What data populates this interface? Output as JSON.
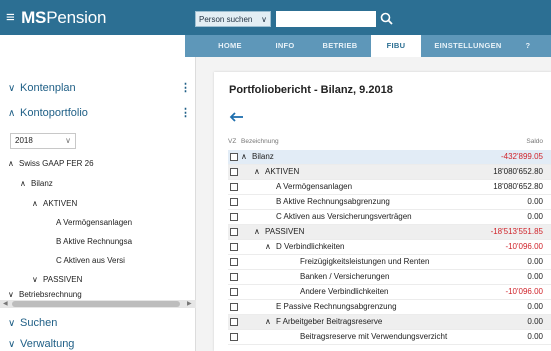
{
  "app": {
    "logo_bold": "MS",
    "logo_rest": "Pension",
    "person_search": "Person suchen",
    "search_value": ""
  },
  "nav": {
    "tabs": [
      {
        "label": "HOME"
      },
      {
        "label": "INFO"
      },
      {
        "label": "BETRIEB"
      },
      {
        "label": "FIBU"
      },
      {
        "label": "EINSTELLUNGEN"
      },
      {
        "label": "?"
      }
    ],
    "active_index": 3
  },
  "sidebar": {
    "kontenplan": "Kontenplan",
    "kontoportfolio": "Kontoportfolio",
    "year": "2018",
    "tree": [
      {
        "label": "Swiss GAAP FER 26"
      },
      {
        "label": "Bilanz"
      },
      {
        "label": "AKTIVEN"
      },
      {
        "label": "A Vermögensanlagen"
      },
      {
        "label": "B Aktive Rechnungsa"
      },
      {
        "label": "C Aktiven aus Versi"
      },
      {
        "label": "PASSIVEN"
      },
      {
        "label": "Betriebsrechnung"
      }
    ],
    "suchen": "Suchen",
    "verwaltung": "Verwaltung"
  },
  "report": {
    "title": "Portfoliobericht - Bilanz, 9.2018",
    "col_vz": "VZ",
    "col_bezeichnung": "Bezeichnung",
    "col_saldo": "Saldo",
    "rows": [
      {
        "label": "Bilanz",
        "value": "-432'899.05",
        "negative": true
      },
      {
        "label": "AKTIVEN",
        "value": "18'080'652.80",
        "negative": false
      },
      {
        "label": "A Vermögensanlagen",
        "value": "18'080'652.80",
        "negative": false
      },
      {
        "label": "B Aktive Rechnungsabgrenzung",
        "value": "0.00",
        "negative": false
      },
      {
        "label": "C Aktiven aus Versicherungsverträgen",
        "value": "0.00",
        "negative": false
      },
      {
        "label": "PASSIVEN",
        "value": "-18'513'551.85",
        "negative": true
      },
      {
        "label": "D Verbindlichkeiten",
        "value": "-10'096.00",
        "negative": true
      },
      {
        "label": "Freizügigkeitsleistungen und Renten",
        "value": "0.00",
        "negative": false
      },
      {
        "label": "Banken / Versicherungen",
        "value": "0.00",
        "negative": false
      },
      {
        "label": "Andere Verbindlichkeiten",
        "value": "-10'096.00",
        "negative": true
      },
      {
        "label": "E Passive Rechnungsabgrenzung",
        "value": "0.00",
        "negative": false
      },
      {
        "label": "F Arbeitgeber Beitragsreserve",
        "value": "0.00",
        "negative": false
      },
      {
        "label": "Beitragsreserve mit Verwendungsverzicht",
        "value": "0.00",
        "negative": false
      }
    ]
  },
  "colors": {
    "topbar": "#2c6f93",
    "navbar": "#5e97b9",
    "negative": "#d0242b",
    "accent": "#1f5f86"
  }
}
